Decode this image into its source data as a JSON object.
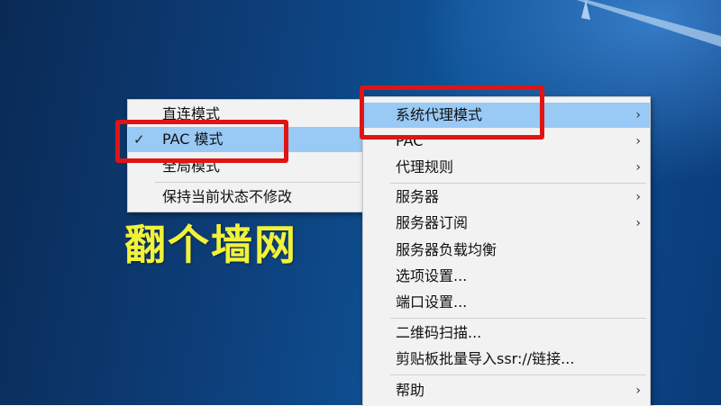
{
  "left_menu": {
    "items": [
      {
        "label": "直连模式",
        "checked": false
      },
      {
        "label": "PAC 模式",
        "checked": true
      },
      {
        "label": "全局模式",
        "checked": false
      },
      {
        "label": "保持当前状态不修改",
        "checked": false
      }
    ],
    "check_mark": "✓"
  },
  "right_menu": {
    "items": [
      {
        "label": "系统代理模式",
        "submenu": true,
        "selected": true
      },
      {
        "label": "PAC",
        "submenu": true
      },
      {
        "label": "代理规则",
        "submenu": true
      },
      {
        "label": "服务器",
        "submenu": true
      },
      {
        "label": "服务器订阅",
        "submenu": true
      },
      {
        "label": "服务器负载均衡",
        "submenu": false
      },
      {
        "label": "选项设置...",
        "submenu": false
      },
      {
        "label": "端口设置...",
        "submenu": false
      },
      {
        "label": "二维码扫描...",
        "submenu": false
      },
      {
        "label": "剪贴板批量导入ssr://链接...",
        "submenu": false
      },
      {
        "label": "帮助",
        "submenu": true
      }
    ],
    "arrow": "›"
  },
  "caption": "翻个墙网",
  "colors": {
    "highlight": "#99c9f5",
    "annotation_red": "#e01414",
    "caption_yellow": "#f1f23a"
  }
}
